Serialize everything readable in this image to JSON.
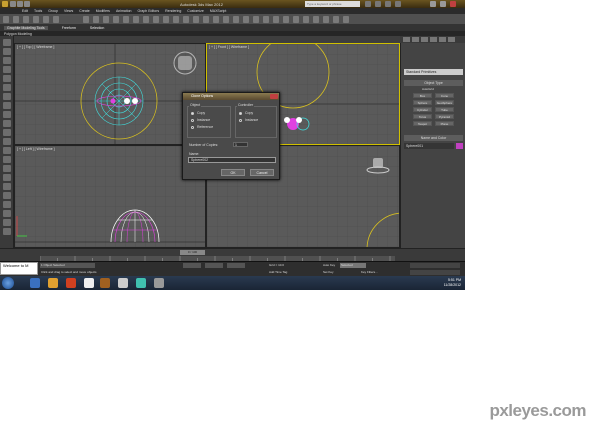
{
  "title": "Autodesk 3ds Max 2012",
  "search_placeholder": "Type a keyword or phrase",
  "menu": [
    "Edit",
    "Tools",
    "Group",
    "Views",
    "Create",
    "Modifiers",
    "Animation",
    "Graph Editors",
    "Rendering",
    "Customize",
    "MAXScript"
  ],
  "ribbon": {
    "tabs": [
      "Graphite Modeling Tools",
      "Freeform",
      "Selection"
    ],
    "sub": "Polygon Modeling"
  },
  "viewports": {
    "top": "[ + ] [ Top ] [ Wireframe ]",
    "front": "[ + ] [ Front ] [ Wireframe ]",
    "left": "[ + ] [ Left ] [ Wireframe ]"
  },
  "command_panel": {
    "dropdown": "Standard Primitives",
    "rollout_object_type": "Object Type",
    "autogrid": "AutoGrid",
    "buttons": [
      "Box",
      "Cone",
      "Sphere",
      "GeoSphere",
      "Cylinder",
      "Tube",
      "Torus",
      "Pyramid",
      "Teapot",
      "Plane"
    ],
    "rollout_name_color": "Name and Color",
    "object_name": "Sphere001",
    "color": "#c040c0"
  },
  "dialog": {
    "title": "Clone Options",
    "object_label": "Object",
    "controller_label": "Controller",
    "object_options": [
      "Copy",
      "Instance",
      "Reference"
    ],
    "object_selected": 0,
    "controller_options": [
      "Copy",
      "Instance"
    ],
    "controller_selected": 0,
    "number_label": "Number of Copies:",
    "number_value": "1",
    "name_label": "Name:",
    "name_value": "Sphere002",
    "ok": "OK",
    "cancel": "Cancel"
  },
  "timeline": {
    "slider": "0 / 100"
  },
  "status": {
    "selected": "1 Object Selected",
    "hint": "Click and drag to select and move objects",
    "grid": "Grid = 10.0",
    "add_time_tag": "Add Time Tag",
    "autokey": "Auto Key",
    "set_key": "Set Key",
    "selected_dropdown": "Selected",
    "key_filters": "Key Filters..."
  },
  "maxscript_label": "Welcome to M",
  "clock": {
    "time": "5:51 PM",
    "date": "11/28/2012"
  },
  "watermark": "pxleyes.com"
}
